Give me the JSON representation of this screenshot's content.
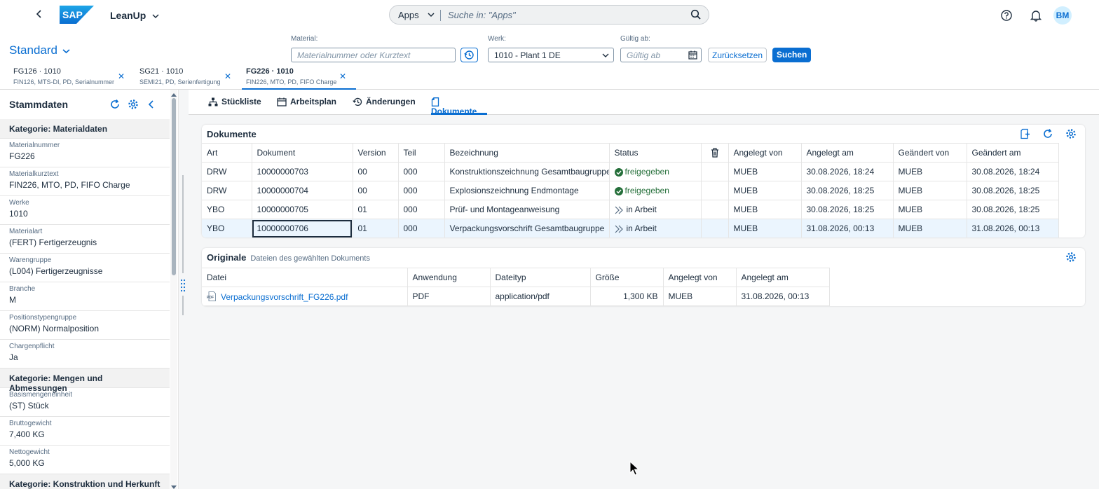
{
  "shell": {
    "logo": "SAP",
    "app_title": "LeanUp",
    "search_scope": "Apps",
    "search_placeholder": "Suche in: \"Apps\"",
    "avatar": "BM"
  },
  "header": {
    "variant": "Standard",
    "filters": {
      "material_label": "Material:",
      "material_placeholder": "Materialnummer oder Kurztext",
      "werk_label": "Werk:",
      "werk_value": "1010 - Plant 1 DE",
      "gueltig_label": "Gültig ab:",
      "gueltig_placeholder": "Gültig ab"
    },
    "reset_label": "Zurücksetzen",
    "search_label": "Suchen",
    "object_tabs": [
      {
        "title": "FG126 · 1010",
        "subtitle": "FIN126, MTS-DI, PD, Serialnummer"
      },
      {
        "title": "SG21 · 1010",
        "subtitle": "SEMI21, PD, Serienfertigung"
      },
      {
        "title": "FG226 · 1010",
        "subtitle": "FIN226, MTO, PD, FIFO Charge"
      }
    ]
  },
  "sidebar": {
    "title": "Stammdaten",
    "items": [
      {
        "type": "category",
        "label": "Kategorie: Materialdaten"
      },
      {
        "type": "field",
        "label": "Materialnummer",
        "value": "FG226"
      },
      {
        "type": "field",
        "label": "Materialkurztext",
        "value": "FIN226, MTO, PD, FIFO Charge"
      },
      {
        "type": "field",
        "label": "Werke",
        "value": "1010"
      },
      {
        "type": "field",
        "label": "Materialart",
        "value": "(FERT) Fertigerzeugnis"
      },
      {
        "type": "field",
        "label": "Warengruppe",
        "value": "(L004) Fertigerzeugnisse"
      },
      {
        "type": "field",
        "label": "Branche",
        "value": "M"
      },
      {
        "type": "field",
        "label": "Positionstypengruppe",
        "value": "(NORM) Normalposition"
      },
      {
        "type": "field",
        "label": "Chargenpflicht",
        "value": "Ja"
      },
      {
        "type": "category",
        "label": "Kategorie: Mengen und Abmessungen"
      },
      {
        "type": "field",
        "label": "Basismengeneinheit",
        "value": "(ST) Stück"
      },
      {
        "type": "field",
        "label": "Bruttogewicht",
        "value": "7,400 KG"
      },
      {
        "type": "field",
        "label": "Nettogewicht",
        "value": "5,000 KG"
      },
      {
        "type": "category",
        "label": "Kategorie: Konstruktion und Herkunft"
      }
    ]
  },
  "tabs": [
    "Stückliste",
    "Arbeitsplan",
    "Änderungen",
    "Dokumente"
  ],
  "dokumente": {
    "title": "Dokumente",
    "columns": [
      "Art",
      "Dokument",
      "Version",
      "Teil",
      "Bezeichnung",
      "Status",
      "",
      "Angelegt von",
      "Angelegt am",
      "Geändert von",
      "Geändert am"
    ],
    "rows": [
      {
        "art": "DRW",
        "dokument": "10000000703",
        "version": "00",
        "teil": "000",
        "bezeichnung": "Konstruktionszeichnung Gesamtbaugruppe",
        "status": "freigegeben",
        "status_type": "ok",
        "angelegt_von": "MUEB",
        "angelegt_am": "30.08.2026, 18:24",
        "geaendert_von": "MUEB",
        "geaendert_am": "30.08.2026, 18:24"
      },
      {
        "art": "DRW",
        "dokument": "10000000704",
        "version": "00",
        "teil": "000",
        "bezeichnung": "Explosionszeichnung Endmontage",
        "status": "freigegeben",
        "status_type": "ok",
        "angelegt_von": "MUEB",
        "angelegt_am": "30.08.2026, 18:25",
        "geaendert_von": "MUEB",
        "geaendert_am": "30.08.2026, 18:25"
      },
      {
        "art": "YBO",
        "dokument": "10000000705",
        "version": "01",
        "teil": "000",
        "bezeichnung": "Prüf- und Montageanweisung",
        "status": "in Arbeit",
        "status_type": "progress",
        "angelegt_von": "MUEB",
        "angelegt_am": "30.08.2026, 18:25",
        "geaendert_von": "MUEB",
        "geaendert_am": "30.08.2026, 18:25"
      },
      {
        "art": "YBO",
        "dokument": "10000000706",
        "version": "01",
        "teil": "000",
        "bezeichnung": "Verpackungsvorschrift Gesamtbaugruppe",
        "status": "in Arbeit",
        "status_type": "progress",
        "angelegt_von": "MUEB",
        "angelegt_am": "31.08.2026, 00:13",
        "geaendert_von": "MUEB",
        "geaendert_am": "31.08.2026, 00:13"
      }
    ]
  },
  "originale": {
    "title": "Originale",
    "subtitle": "Dateien des gewählten Dokuments",
    "columns": [
      "Datei",
      "Anwendung",
      "Dateityp",
      "Größe",
      "Angelegt von",
      "Angelegt am"
    ],
    "rows": [
      {
        "datei": "Verpackungsvorschrift_FG226.pdf",
        "anwendung": "PDF",
        "dateityp": "application/pdf",
        "groesse": "1,300 KB",
        "angelegt_von": "MUEB",
        "angelegt_am": "31.08.2026, 00:13"
      }
    ]
  },
  "colors": {
    "accent": "#0a6ed1",
    "positive": "#256f3a",
    "selected_row": "#ebf5fe"
  }
}
